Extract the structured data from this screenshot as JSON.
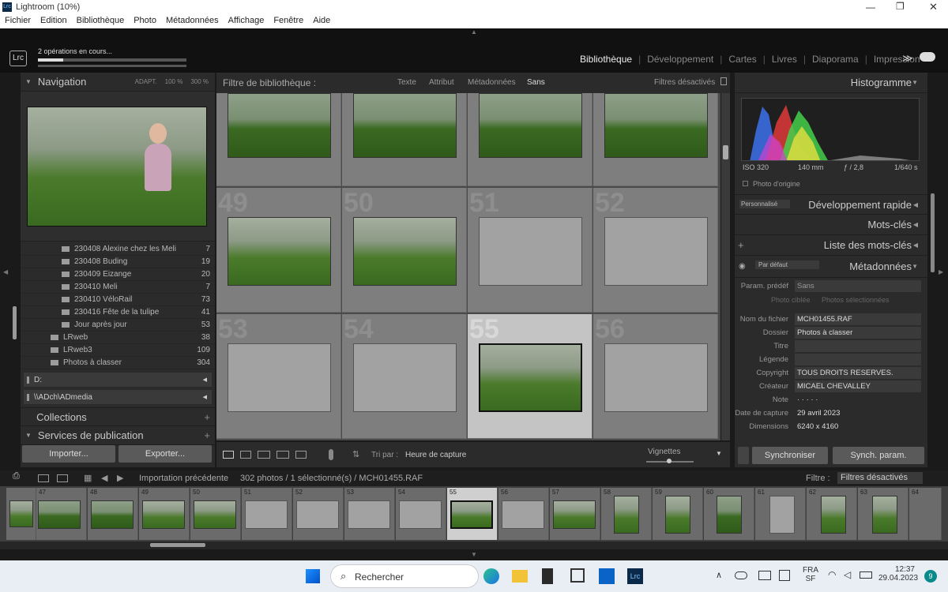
{
  "window": {
    "title": "Lightroom (10%)",
    "app_badge": "Lrc"
  },
  "menu": [
    "Fichier",
    "Edition",
    "Bibliothèque",
    "Photo",
    "Métadonnées",
    "Affichage",
    "Fenêtre",
    "Aide"
  ],
  "top": {
    "operations": "2 opérations en cours...",
    "modules": [
      "Bibliothèque",
      "Développement",
      "Cartes",
      "Livres",
      "Diaporama",
      "Impression"
    ],
    "active": "Bibliothèque",
    "more": "≫"
  },
  "left": {
    "navigation": {
      "title": "Navigation",
      "fit": "ADAPT.",
      "z1": "100 %",
      "z2": "300 %"
    },
    "folders": [
      {
        "name": "230408 Alexine chez les Meli",
        "count": "7"
      },
      {
        "name": "230408 Buding",
        "count": "19"
      },
      {
        "name": "230409 Eizange",
        "count": "20"
      },
      {
        "name": "230410 Meli",
        "count": "7"
      },
      {
        "name": "230410 VéloRail",
        "count": "73"
      },
      {
        "name": "230416 Fête de la tulipe",
        "count": "41"
      },
      {
        "name": "Jour après jour",
        "count": "53"
      }
    ],
    "folders2": [
      {
        "name": "LRweb",
        "count": "38"
      },
      {
        "name": "LRweb3",
        "count": "109"
      },
      {
        "name": "Photos à classer",
        "count": "304"
      }
    ],
    "volumes": [
      "D:",
      "\\\\ADch\\ADmedia"
    ],
    "collections": "Collections",
    "publish": "Services de publication",
    "import_btn": "Importer...",
    "export_btn": "Exporter..."
  },
  "filter": {
    "title": "Filtre de bibliothèque :",
    "options": [
      "Texte",
      "Attribut",
      "Métadonnées",
      "Sans"
    ],
    "active": "Sans",
    "status": "Filtres désactivés"
  },
  "grid": {
    "row2": [
      "49",
      "50",
      "51",
      "52"
    ],
    "row3": [
      "53",
      "54",
      "55",
      "56"
    ]
  },
  "toolbar": {
    "sort_label": "Tri par :",
    "sort_value": "Heure de capture",
    "thumbs_label": "Vignettes"
  },
  "right": {
    "histogram": "Histogramme",
    "exif": [
      "ISO 320",
      "140 mm",
      "ƒ / 2,8",
      "1/640 s"
    ],
    "original": "Photo d'origine",
    "quick_dev": "Développement rapide",
    "preset": "Personnalisé",
    "keywords": "Mots-clés",
    "keyword_list": "Liste des mots-clés",
    "metadata": "Métadonnées",
    "default": "Par défaut",
    "preset_label": "Param. prédéf",
    "preset_value": "Sans",
    "target": "Photo ciblée",
    "selected": "Photos sélectionnées",
    "fields": [
      {
        "k": "Nom du fichier",
        "v": "MCH01455.RAF"
      },
      {
        "k": "Dossier",
        "v": "Photos à classer"
      },
      {
        "k": "Titre",
        "v": ""
      },
      {
        "k": "Légende",
        "v": ""
      },
      {
        "k": "Copyright",
        "v": "TOUS DROITS RESERVES."
      },
      {
        "k": "Créateur",
        "v": "MICAEL CHEVALLEY"
      },
      {
        "k": "Note",
        "v": "·   ·   ·   ·   ·"
      },
      {
        "k": "Date de capture",
        "v": "29 avril 2023"
      },
      {
        "k": "Dimensions",
        "v": "6240 x 4160"
      }
    ],
    "sync_btn": "Synchroniser",
    "sync_params_btn": "Synch. param."
  },
  "filmhdr": {
    "source": "Importation précédente",
    "info": "302 photos / 1 sélectionné(s) / MCH01455.RAF",
    "filter_label": "Filtre :",
    "filter_value": "Filtres désactivés"
  },
  "filmstrip": {
    "numbers": [
      "47",
      "48",
      "49",
      "50",
      "51",
      "52",
      "53",
      "54",
      "55",
      "56",
      "57",
      "58",
      "59",
      "60",
      "61",
      "62",
      "63",
      "64"
    ]
  },
  "taskbar": {
    "search": "Rechercher",
    "lang1": "FRA",
    "lang2": "SF",
    "time": "12:37",
    "date": "29.04.2023",
    "badge": "9"
  }
}
